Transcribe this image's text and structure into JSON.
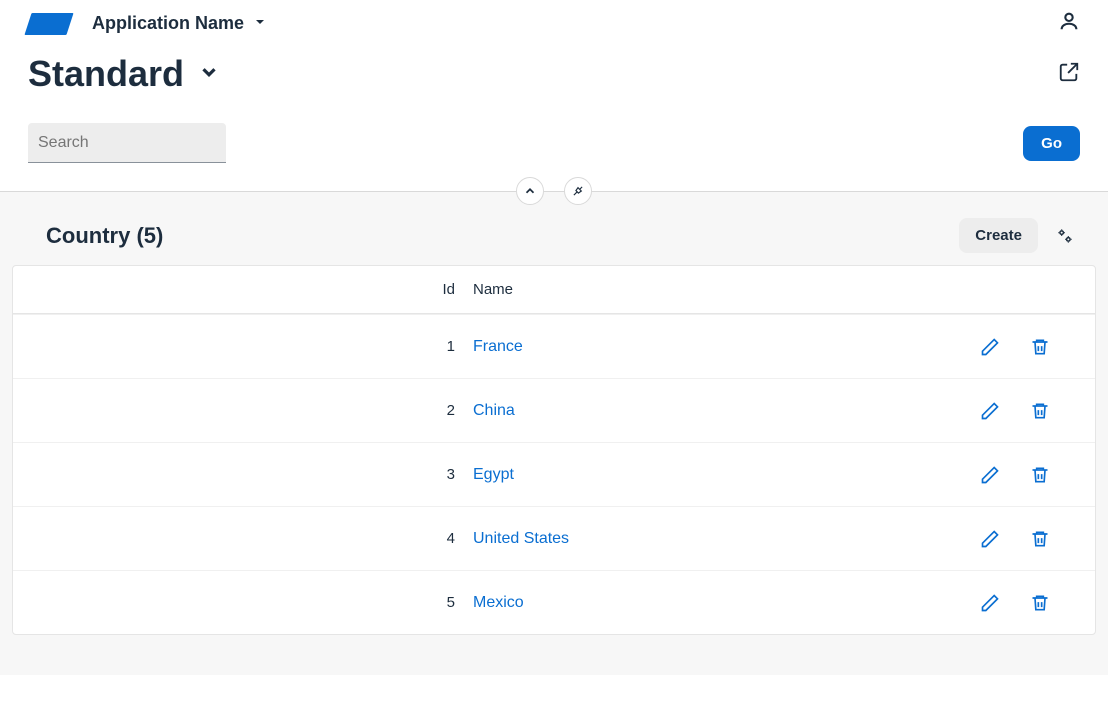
{
  "header": {
    "app_name": "Application Name"
  },
  "page": {
    "title": "Standard"
  },
  "search": {
    "placeholder": "Search",
    "go_label": "Go"
  },
  "panel": {
    "title": "Country (5)",
    "create_label": "Create",
    "columns": {
      "id": "Id",
      "name": "Name"
    },
    "rows": [
      {
        "id": "1",
        "name": "France"
      },
      {
        "id": "2",
        "name": "China"
      },
      {
        "id": "3",
        "name": "Egypt"
      },
      {
        "id": "4",
        "name": "United States"
      },
      {
        "id": "5",
        "name": "Mexico"
      }
    ]
  }
}
